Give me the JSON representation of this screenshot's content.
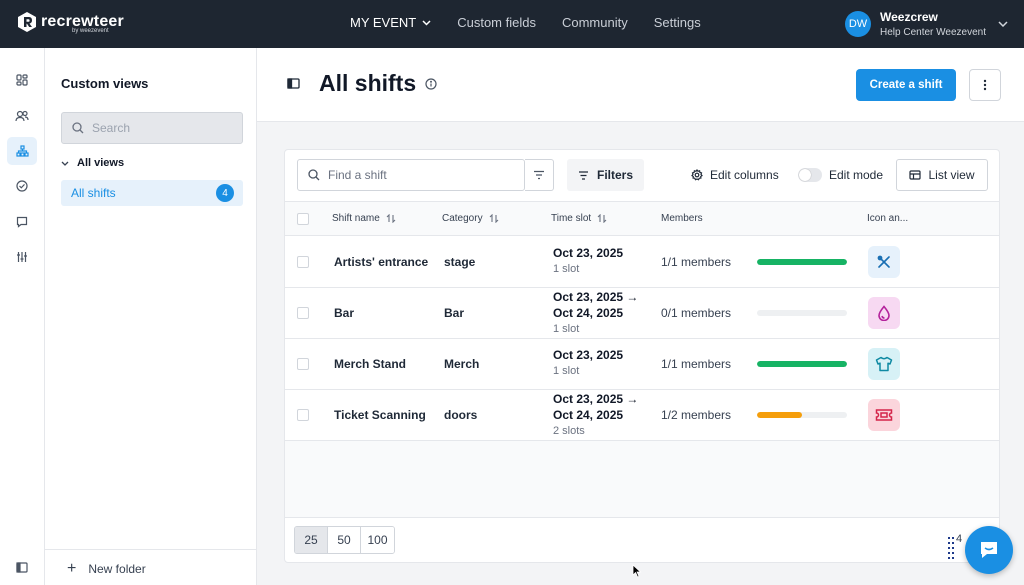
{
  "app": {
    "logo_text": "recrewteer",
    "logo_sub": "by weezevent"
  },
  "topnav": {
    "items": [
      {
        "label": "MY EVENT",
        "has_dropdown": true
      },
      {
        "label": "Custom fields"
      },
      {
        "label": "Community"
      },
      {
        "label": "Settings"
      }
    ]
  },
  "user": {
    "initials": "DW",
    "name": "Weezcrew",
    "subtitle": "Help Center Weezevent"
  },
  "rail": {
    "icons": [
      "dashboard-icon",
      "users-icon",
      "org-chart-icon",
      "check-circle-icon",
      "chat-icon",
      "sliders-icon",
      "panel-toggle-icon"
    ],
    "active": "org-chart-icon"
  },
  "views_panel": {
    "title": "Custom views",
    "search_placeholder": "Search",
    "group_label": "All views",
    "items": [
      {
        "label": "All shifts",
        "count": "4"
      }
    ],
    "new_folder_label": "New folder"
  },
  "page": {
    "title": "All shifts",
    "create_button": "Create a shift"
  },
  "toolbar": {
    "search_placeholder": "Find a shift",
    "filters_label": "Filters",
    "edit_columns_label": "Edit columns",
    "edit_mode_label": "Edit mode",
    "edit_mode_on": false,
    "list_view_label": "List view"
  },
  "table": {
    "columns": [
      "Shift name",
      "Category",
      "Time slot",
      "Members",
      "Icon an..."
    ],
    "rows": [
      {
        "name": "Artists' entrance",
        "category": "stage",
        "date1": "Oct 23, 2025",
        "date2": "",
        "slots": "1 slot",
        "members": "1/1 members",
        "fill": 1.0,
        "bar_color": "#16b364",
        "icon": "tools-icon",
        "icon_bg": "#e6f1fb",
        "icon_color": "#1a6fb3"
      },
      {
        "name": "Bar",
        "category": "Bar",
        "date1": "Oct 23, 2025 →",
        "date2": "Oct 24, 2025",
        "slots": "1 slot",
        "members": "0/1 members",
        "fill": 0.0,
        "bar_color": "#16b364",
        "icon": "drop-icon",
        "icon_bg": "#f7d9f2",
        "icon_color": "#b4239c"
      },
      {
        "name": "Merch Stand",
        "category": "Merch",
        "date1": "Oct 23, 2025",
        "date2": "",
        "slots": "1 slot",
        "members": "1/1 members",
        "fill": 1.0,
        "bar_color": "#16b364",
        "icon": "tshirt-icon",
        "icon_bg": "#d7f1f6",
        "icon_color": "#0f8aa3"
      },
      {
        "name": "Ticket Scanning",
        "category": "doors",
        "date1": "Oct 23, 2025 →",
        "date2": "Oct 24, 2025",
        "slots": "2 slots",
        "members": "1/2 members",
        "fill": 0.5,
        "bar_color": "#f59e0b",
        "icon": "ticket-icon",
        "icon_bg": "#fbd5dc",
        "icon_color": "#d4254a"
      }
    ]
  },
  "pagination": {
    "options": [
      "25",
      "50",
      "100"
    ],
    "selected": "25"
  },
  "chat": {
    "count": "4"
  },
  "colors": {
    "topbar": "#1e2631",
    "accent": "#1a8fe3"
  }
}
